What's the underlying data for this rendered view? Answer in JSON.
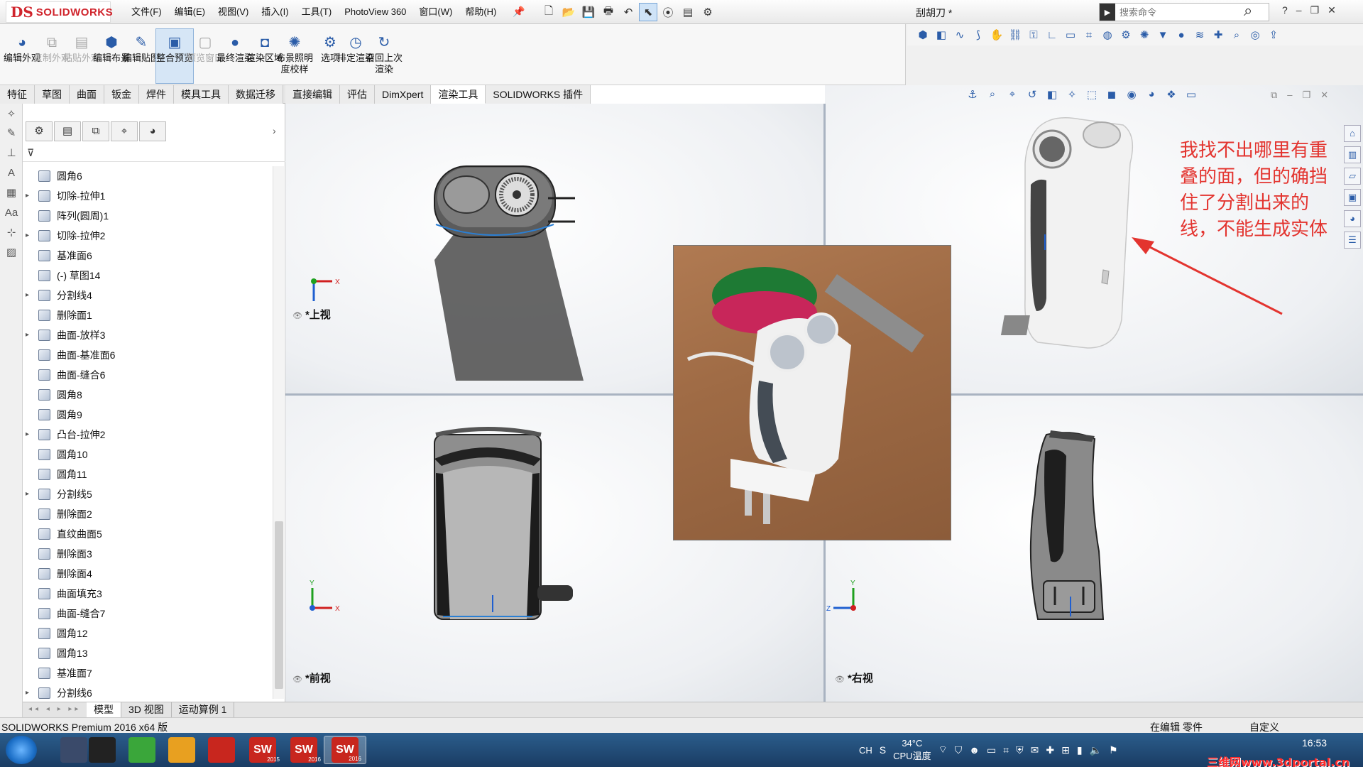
{
  "app": {
    "logo_ds": "DS",
    "logo_text": "SOLIDWORKS",
    "document_title": "刮胡刀 *"
  },
  "menu": [
    "文件(F)",
    "编辑(E)",
    "视图(V)",
    "插入(I)",
    "工具(T)",
    "PhotoView 360",
    "窗口(W)",
    "帮助(H)"
  ],
  "search": {
    "placeholder": "搜索命令",
    "help": "?"
  },
  "commands": [
    {
      "label": "编辑外观",
      "icon": "appearance-icon",
      "state": "enabled"
    },
    {
      "label": "复制外观",
      "icon": "copy-icon",
      "state": "disabled"
    },
    {
      "label": "粘贴外观",
      "icon": "paste-icon",
      "state": "disabled"
    },
    {
      "label": "编辑布景",
      "icon": "scene-icon",
      "state": "enabled"
    },
    {
      "label": "编辑贴图",
      "icon": "decal-icon",
      "state": "enabled"
    },
    {
      "label": "整合预览",
      "icon": "preview-icon",
      "state": "selected"
    },
    {
      "label": "预览窗口",
      "icon": "window-icon",
      "state": "disabled"
    },
    {
      "label": "最终渲染",
      "icon": "render-icon",
      "state": "enabled"
    },
    {
      "label": "渲染区域",
      "icon": "region-icon",
      "state": "enabled"
    },
    {
      "label": "布景照明度校样",
      "icon": "light-icon",
      "state": "enabled"
    },
    {
      "label": "选项",
      "icon": "options-icon",
      "state": "enabled"
    },
    {
      "label": "排定渲染",
      "icon": "schedule-icon",
      "state": "enabled"
    },
    {
      "label": "召回上次渲染",
      "icon": "recall-icon",
      "state": "enabled"
    }
  ],
  "tabs": [
    {
      "label": "特征",
      "active": false
    },
    {
      "label": "草图",
      "active": false
    },
    {
      "label": "曲面",
      "active": false
    },
    {
      "label": "钣金",
      "active": false
    },
    {
      "label": "焊件",
      "active": false
    },
    {
      "label": "模具工具",
      "active": false
    },
    {
      "label": "数据迁移",
      "active": false
    },
    {
      "label": "直接编辑",
      "active": false
    },
    {
      "label": "评估",
      "active": false
    },
    {
      "label": "DimXpert",
      "active": false
    },
    {
      "label": "渲染工具",
      "active": true
    },
    {
      "label": "SOLIDWORKS 插件",
      "active": false
    }
  ],
  "tree": [
    {
      "label": "圆角6",
      "expandable": false
    },
    {
      "label": "切除-拉伸1",
      "expandable": true
    },
    {
      "label": "阵列(圆周)1",
      "expandable": false
    },
    {
      "label": "切除-拉伸2",
      "expandable": true
    },
    {
      "label": "基准面6",
      "expandable": false
    },
    {
      "label": "(-) 草图14",
      "expandable": false
    },
    {
      "label": "分割线4",
      "expandable": true
    },
    {
      "label": "删除面1",
      "expandable": false
    },
    {
      "label": "曲面-放样3",
      "expandable": true
    },
    {
      "label": "曲面-基准面6",
      "expandable": false
    },
    {
      "label": "曲面-缝合6",
      "expandable": false
    },
    {
      "label": "圆角8",
      "expandable": false
    },
    {
      "label": "圆角9",
      "expandable": false
    },
    {
      "label": "凸台-拉伸2",
      "expandable": true
    },
    {
      "label": "圆角10",
      "expandable": false
    },
    {
      "label": "圆角11",
      "expandable": false
    },
    {
      "label": "分割线5",
      "expandable": true
    },
    {
      "label": "删除面2",
      "expandable": false
    },
    {
      "label": "直纹曲面5",
      "expandable": false
    },
    {
      "label": "删除面3",
      "expandable": false
    },
    {
      "label": "删除面4",
      "expandable": false
    },
    {
      "label": "曲面填充3",
      "expandable": false
    },
    {
      "label": "曲面-缝合7",
      "expandable": false
    },
    {
      "label": "圆角12",
      "expandable": false
    },
    {
      "label": "圆角13",
      "expandable": false
    },
    {
      "label": "基准面7",
      "expandable": false
    },
    {
      "label": "分割线6",
      "expandable": true
    }
  ],
  "viewports": {
    "top": "*上视",
    "front": "*前视",
    "right": "*右视",
    "axis_x": "X",
    "axis_y": "Y",
    "axis_z": "Z"
  },
  "annotation": "我找不出哪里有重叠的面，但的确挡住了分割出来的线，不能生成实体",
  "bottom_tabs": [
    {
      "label": "模型",
      "active": true
    },
    {
      "label": "3D 视图",
      "active": false
    },
    {
      "label": "运动算例 1",
      "active": false
    }
  ],
  "status": {
    "left": "SOLIDWORKS Premium 2016 x64 版",
    "editing": "在编辑 零件",
    "custom": "自定义"
  },
  "taskbar": {
    "apps": [
      {
        "label": "",
        "icon": "solidworks-logo-icon",
        "color": "#3a4a6a",
        "active": false
      },
      {
        "label": "",
        "icon": "qq-icon",
        "color": "#222222",
        "active": false
      },
      {
        "label": "",
        "icon": "browser-icon",
        "color": "#3aa63a",
        "active": false
      },
      {
        "label": "",
        "icon": "folder-icon",
        "color": "#e8a020",
        "active": false
      },
      {
        "label": "",
        "icon": "autocad-icon",
        "color": "#c8261e",
        "active": false
      },
      {
        "label": "SW",
        "sub": "2015",
        "icon": "sw2015-icon",
        "color": "#c8261e",
        "active": false
      },
      {
        "label": "SW",
        "sub": "2016",
        "icon": "sw2016-icon",
        "color": "#c8261e",
        "active": false
      },
      {
        "label": "SW",
        "sub": "2016",
        "icon": "sw2016-icon",
        "color": "#c8261e",
        "active": true
      }
    ],
    "ime": "CH",
    "temperature": "34°C",
    "temp_label": "CPU温度",
    "clock": "16:53",
    "watermark": "三维网www.3dportal.cn"
  }
}
